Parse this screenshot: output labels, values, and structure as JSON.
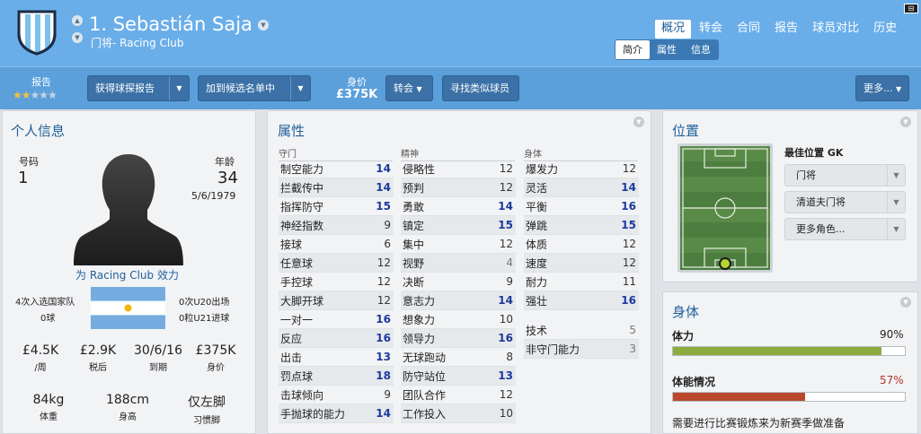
{
  "header": {
    "player_name": "1. Sebastián Saja",
    "subtitle": "门将- Racing Club",
    "nav": [
      "概况",
      "转会",
      "合同",
      "报告",
      "球员对比",
      "历史"
    ],
    "subtabs": [
      "简介",
      "属性",
      "信息"
    ],
    "corner_badge": "⊟"
  },
  "toolbar": {
    "report_label": "报告",
    "stars": {
      "filled": 2,
      "total": 5
    },
    "get_report_btn": "获得球探报告",
    "shortlist_btn": "加到候选名单中",
    "value_label": "身价",
    "value": "£375K",
    "transfer_btn": "转会",
    "similar_btn": "寻找类似球员",
    "more_btn": "更多..."
  },
  "personal": {
    "title": "个人信息",
    "number_label": "号码",
    "number": "1",
    "age_label": "年龄",
    "age": "34",
    "dob": "5/6/1979",
    "club_line": "为 Racing Club 效力",
    "caps": "4次入选国家队",
    "goals": "0球",
    "u20": "0次U20出场",
    "u21": "0粒U21进球",
    "facts": [
      {
        "value": "£4.5K",
        "label": "/周"
      },
      {
        "value": "£2.9K",
        "label": "税后"
      },
      {
        "value": "30/6/16",
        "label": "到期"
      },
      {
        "value": "£375K",
        "label": "身价"
      }
    ],
    "body": [
      {
        "value": "84kg",
        "label": "体重"
      },
      {
        "value": "188cm",
        "label": "身高"
      },
      {
        "value": "仅左脚",
        "label": "习惯脚"
      }
    ]
  },
  "attributes": {
    "title": "属性",
    "columns": [
      {
        "head": "守门",
        "rows": [
          [
            "制空能力",
            "14"
          ],
          [
            "拦截传中",
            "14"
          ],
          [
            "指挥防守",
            "15"
          ],
          [
            "神经指数",
            "9"
          ],
          [
            "接球",
            "6"
          ],
          [
            "任意球",
            "12"
          ],
          [
            "手控球",
            "12"
          ],
          [
            "大脚开球",
            "12"
          ],
          [
            "一对一",
            "16"
          ],
          [
            "反应",
            "16"
          ],
          [
            "出击",
            "13"
          ],
          [
            "罚点球",
            "18"
          ],
          [
            "击球倾向",
            "9"
          ],
          [
            "手抛球的能力",
            "14"
          ]
        ]
      },
      {
        "head": "精神",
        "rows": [
          [
            "侵略性",
            "12"
          ],
          [
            "预判",
            "12"
          ],
          [
            "勇敢",
            "14"
          ],
          [
            "镇定",
            "15"
          ],
          [
            "集中",
            "12"
          ],
          [
            "视野",
            "4"
          ],
          [
            "决断",
            "9"
          ],
          [
            "意志力",
            "14"
          ],
          [
            "想象力",
            "10"
          ],
          [
            "领导力",
            "16"
          ],
          [
            "无球跑动",
            "8"
          ],
          [
            "防守站位",
            "13"
          ],
          [
            "团队合作",
            "12"
          ],
          [
            "工作投入",
            "10"
          ]
        ]
      },
      {
        "head": "身体",
        "rows": [
          [
            "爆发力",
            "12"
          ],
          [
            "灵活",
            "14"
          ],
          [
            "平衡",
            "16"
          ],
          [
            "弹跳",
            "15"
          ],
          [
            "体质",
            "12"
          ],
          [
            "速度",
            "12"
          ],
          [
            "耐力",
            "11"
          ],
          [
            "强壮",
            "16"
          ]
        ]
      },
      {
        "head": "",
        "rows": [
          [
            "技术",
            "5"
          ],
          [
            "非守门能力",
            "3"
          ]
        ]
      }
    ]
  },
  "position": {
    "title": "位置",
    "best_label": "最佳位置 GK",
    "dropdowns": [
      "门将",
      "清道夫门将",
      "更多角色..."
    ]
  },
  "physical": {
    "title": "身体",
    "stamina_label": "体力",
    "stamina_pct": "90%",
    "stamina_value": 0.9,
    "fitness_label": "体能情况",
    "fitness_pct": "57%",
    "fitness_value": 0.57,
    "note": "需要进行比赛锻炼来为新赛季做准备",
    "colors": {
      "stamina": "#8bab3f",
      "fitness": "#b9482d",
      "fitness_text": "#b2332a"
    }
  }
}
